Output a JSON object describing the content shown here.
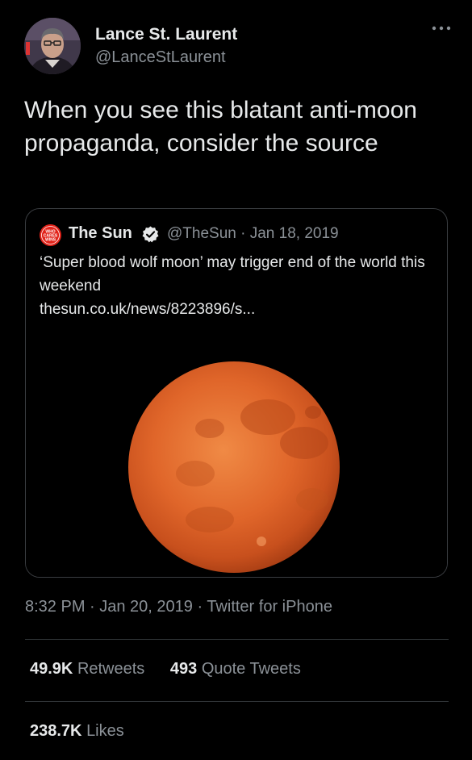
{
  "author": {
    "display_name": "Lance St. Laurent",
    "handle": "@LanceStLaurent",
    "avatar_icon": "profile-photo"
  },
  "tweet": {
    "text": "When you see this blatant anti-moon propaganda, consider the source",
    "timestamp": "8:32 PM · Jan 20, 2019 · Twitter for iPhone"
  },
  "quoted_tweet": {
    "logo_text": "WHO CARES WINS",
    "name": "The Sun",
    "verified": true,
    "meta": "@TheSun · Jan 18, 2019",
    "text": "‘Super blood wolf moon’ may trigger end of the world this weekend",
    "link": "thesun.co.uk/news/8223896/s...",
    "image": "red-moon"
  },
  "stats": {
    "retweets_count": "49.9K",
    "retweets_label": "Retweets",
    "quotes_count": "493",
    "quotes_label": "Quote Tweets",
    "likes_count": "238.7K",
    "likes_label": "Likes"
  },
  "colors": {
    "background": "#000000",
    "text_primary": "#e7e9ea",
    "text_secondary": "#8b9197",
    "divider": "#2f3336",
    "moon": "#e0662a",
    "sun_logo": "#e2231a"
  }
}
